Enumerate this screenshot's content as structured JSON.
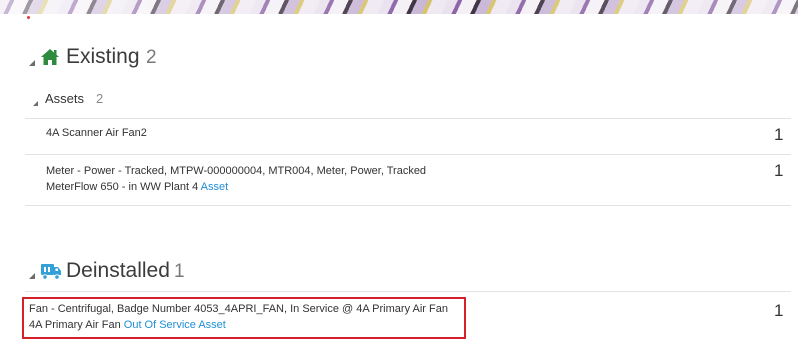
{
  "colors": {
    "accent_green": "#2e8b3e",
    "accent_blue": "#33a1d8",
    "link": "#1f8fd4",
    "highlight_red": "#d8202a"
  },
  "existing": {
    "title": "Existing",
    "count": "2",
    "icon": "home-icon",
    "group": {
      "title": "Assets",
      "count": "2",
      "rows": [
        {
          "line1": "4A Scanner Air Fan2",
          "qty": "1"
        },
        {
          "line1": "Meter - Power - Tracked, MTPW-000000004, MTR004, Meter, Power, Tracked",
          "line2": "MeterFlow 650 - in WW Plant 4",
          "link": "Asset",
          "qty": "1"
        }
      ]
    }
  },
  "deinstalled": {
    "title": "Deinstalled",
    "count": "1",
    "icon": "truck-icon",
    "rows": [
      {
        "line1": "Fan - Centrifugal, Badge Number 4053_4APRI_FAN, In Service @ 4A Primary Air Fan",
        "line2": "4A Primary Air Fan",
        "link": "Out Of Service Asset",
        "qty": "1"
      }
    ]
  }
}
